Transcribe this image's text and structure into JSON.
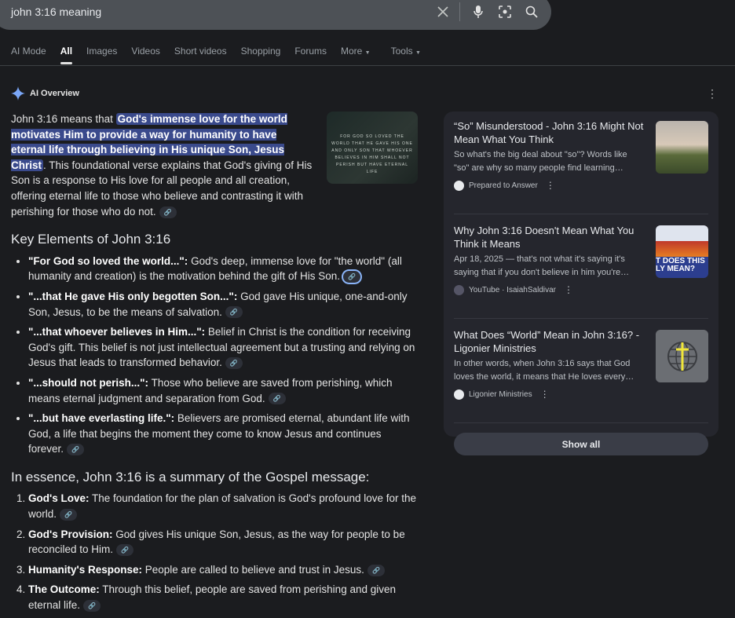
{
  "search": {
    "query": "john 3:16 meaning",
    "icons": [
      "close-icon",
      "mic-icon",
      "lens-icon",
      "search-icon"
    ]
  },
  "tabs": [
    "AI Mode",
    "All",
    "Images",
    "Videos",
    "Short videos",
    "Shopping",
    "Forums",
    "More",
    "Tools"
  ],
  "ai": {
    "title": "AI Overview",
    "intro_pre": "John 3:16 means that ",
    "intro_hl": "God's immense love for the world motivates Him to provide a way for humanity to have eternal life through believing in His unique Son, Jesus Christ",
    "intro_post": ". This foundational verse explains that God's giving of His Son is a response to His love for all people and all creation, offering eternal life to those who believe and contrasting it with perishing for those who do not.",
    "image_text": "FOR GOD SO LOVED THE WORLD THAT HE GAVE HIS ONE AND ONLY SON THAT WHOEVER BELIEVES IN HIM SHALL NOT PERISH BUT HAVE ETERNAL LIFE",
    "h1": "Key Elements of John 3:16",
    "bullets": [
      {
        "b": "\"For God so loved the world...\":",
        "t": " God's deep, immense love for \"the world\" (all humanity and creation) is the motivation behind the gift of His Son."
      },
      {
        "b": "\"...that He gave His only begotten Son...\":",
        "t": " God gave His unique, one-and-only Son, Jesus, to be the means of salvation."
      },
      {
        "b": "\"...that whoever believes in Him...\":",
        "t": " Belief in Christ is the condition for receiving God's gift. This belief is not just intellectual agreement but a trusting and relying on Jesus that leads to transformed behavior."
      },
      {
        "b": "\"...should not perish...\":",
        "t": " Those who believe are saved from perishing, which means eternal judgment and separation from God."
      },
      {
        "b": "\"...but have everlasting life.\":",
        "t": " Believers are promised eternal, abundant life with God, a life that begins the moment they come to know Jesus and continues forever."
      }
    ],
    "h2": "In essence, John 3:16 is a summary of the Gospel message:",
    "numbered": [
      {
        "b": "God's Love:",
        "t": " The foundation for the plan of salvation is God's profound love for the world."
      },
      {
        "b": "God's Provision:",
        "t": " God gives His unique Son, Jesus, as the way for people to be reconciled to Him."
      },
      {
        "b": "Humanity's Response:",
        "t": " People are called to believe and trust in Jesus."
      },
      {
        "b": "The Outcome:",
        "t": " Through this belief, people are saved from perishing and given eternal life."
      }
    ]
  },
  "sources": [
    {
      "title": "“So” Misunderstood - John 3:16 Might Not Mean What You Think",
      "desc": "So what's the big deal about \"so\"? Words like \"so\" are why so many people find learning…",
      "site": "Prepared to Answer"
    },
    {
      "title": "Why John 3:16 Doesn't Mean What You Think it Means",
      "desc": "Apr 18, 2025 — that's not what it's saying it's saying that if you don't believe in him you're…",
      "site": "YouTube · IsaiahSaldivar",
      "thumb_text": "T DOES THIS LY MEAN?"
    },
    {
      "title": "What Does “World” Mean in John 3:16? - Ligonier Ministries",
      "desc": "In other words, when John 3:16 says that God loves the world, it means that He loves every…",
      "site": "Ligonier Ministries"
    }
  ],
  "show_all": "Show all"
}
